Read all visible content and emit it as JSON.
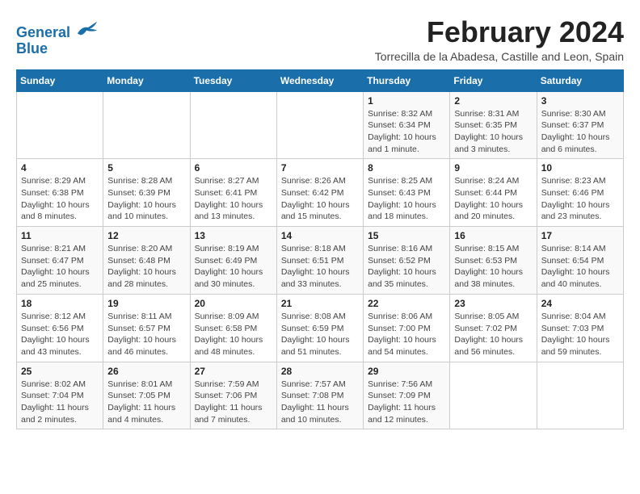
{
  "header": {
    "logo_line1": "General",
    "logo_line2": "Blue",
    "month_title": "February 2024",
    "subtitle": "Torrecilla de la Abadesa, Castille and Leon, Spain"
  },
  "days_of_week": [
    "Sunday",
    "Monday",
    "Tuesday",
    "Wednesday",
    "Thursday",
    "Friday",
    "Saturday"
  ],
  "weeks": [
    [
      {
        "day": "",
        "info": ""
      },
      {
        "day": "",
        "info": ""
      },
      {
        "day": "",
        "info": ""
      },
      {
        "day": "",
        "info": ""
      },
      {
        "day": "1",
        "info": "Sunrise: 8:32 AM\nSunset: 6:34 PM\nDaylight: 10 hours and 1 minute."
      },
      {
        "day": "2",
        "info": "Sunrise: 8:31 AM\nSunset: 6:35 PM\nDaylight: 10 hours and 3 minutes."
      },
      {
        "day": "3",
        "info": "Sunrise: 8:30 AM\nSunset: 6:37 PM\nDaylight: 10 hours and 6 minutes."
      }
    ],
    [
      {
        "day": "4",
        "info": "Sunrise: 8:29 AM\nSunset: 6:38 PM\nDaylight: 10 hours and 8 minutes."
      },
      {
        "day": "5",
        "info": "Sunrise: 8:28 AM\nSunset: 6:39 PM\nDaylight: 10 hours and 10 minutes."
      },
      {
        "day": "6",
        "info": "Sunrise: 8:27 AM\nSunset: 6:41 PM\nDaylight: 10 hours and 13 minutes."
      },
      {
        "day": "7",
        "info": "Sunrise: 8:26 AM\nSunset: 6:42 PM\nDaylight: 10 hours and 15 minutes."
      },
      {
        "day": "8",
        "info": "Sunrise: 8:25 AM\nSunset: 6:43 PM\nDaylight: 10 hours and 18 minutes."
      },
      {
        "day": "9",
        "info": "Sunrise: 8:24 AM\nSunset: 6:44 PM\nDaylight: 10 hours and 20 minutes."
      },
      {
        "day": "10",
        "info": "Sunrise: 8:23 AM\nSunset: 6:46 PM\nDaylight: 10 hours and 23 minutes."
      }
    ],
    [
      {
        "day": "11",
        "info": "Sunrise: 8:21 AM\nSunset: 6:47 PM\nDaylight: 10 hours and 25 minutes."
      },
      {
        "day": "12",
        "info": "Sunrise: 8:20 AM\nSunset: 6:48 PM\nDaylight: 10 hours and 28 minutes."
      },
      {
        "day": "13",
        "info": "Sunrise: 8:19 AM\nSunset: 6:49 PM\nDaylight: 10 hours and 30 minutes."
      },
      {
        "day": "14",
        "info": "Sunrise: 8:18 AM\nSunset: 6:51 PM\nDaylight: 10 hours and 33 minutes."
      },
      {
        "day": "15",
        "info": "Sunrise: 8:16 AM\nSunset: 6:52 PM\nDaylight: 10 hours and 35 minutes."
      },
      {
        "day": "16",
        "info": "Sunrise: 8:15 AM\nSunset: 6:53 PM\nDaylight: 10 hours and 38 minutes."
      },
      {
        "day": "17",
        "info": "Sunrise: 8:14 AM\nSunset: 6:54 PM\nDaylight: 10 hours and 40 minutes."
      }
    ],
    [
      {
        "day": "18",
        "info": "Sunrise: 8:12 AM\nSunset: 6:56 PM\nDaylight: 10 hours and 43 minutes."
      },
      {
        "day": "19",
        "info": "Sunrise: 8:11 AM\nSunset: 6:57 PM\nDaylight: 10 hours and 46 minutes."
      },
      {
        "day": "20",
        "info": "Sunrise: 8:09 AM\nSunset: 6:58 PM\nDaylight: 10 hours and 48 minutes."
      },
      {
        "day": "21",
        "info": "Sunrise: 8:08 AM\nSunset: 6:59 PM\nDaylight: 10 hours and 51 minutes."
      },
      {
        "day": "22",
        "info": "Sunrise: 8:06 AM\nSunset: 7:00 PM\nDaylight: 10 hours and 54 minutes."
      },
      {
        "day": "23",
        "info": "Sunrise: 8:05 AM\nSunset: 7:02 PM\nDaylight: 10 hours and 56 minutes."
      },
      {
        "day": "24",
        "info": "Sunrise: 8:04 AM\nSunset: 7:03 PM\nDaylight: 10 hours and 59 minutes."
      }
    ],
    [
      {
        "day": "25",
        "info": "Sunrise: 8:02 AM\nSunset: 7:04 PM\nDaylight: 11 hours and 2 minutes."
      },
      {
        "day": "26",
        "info": "Sunrise: 8:01 AM\nSunset: 7:05 PM\nDaylight: 11 hours and 4 minutes."
      },
      {
        "day": "27",
        "info": "Sunrise: 7:59 AM\nSunset: 7:06 PM\nDaylight: 11 hours and 7 minutes."
      },
      {
        "day": "28",
        "info": "Sunrise: 7:57 AM\nSunset: 7:08 PM\nDaylight: 11 hours and 10 minutes."
      },
      {
        "day": "29",
        "info": "Sunrise: 7:56 AM\nSunset: 7:09 PM\nDaylight: 11 hours and 12 minutes."
      },
      {
        "day": "",
        "info": ""
      },
      {
        "day": "",
        "info": ""
      }
    ]
  ]
}
